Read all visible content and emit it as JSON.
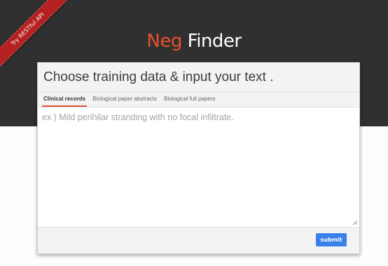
{
  "ribbon": {
    "label": "Try RESTful API"
  },
  "brand": {
    "accent": "Neg",
    "name": "Finder",
    "accent_color": "#e8522c"
  },
  "card": {
    "title": "Choose training data & input your text ."
  },
  "tabs": [
    {
      "label": "Clinical records",
      "active": true
    },
    {
      "label": "Biological paper abstracts",
      "active": false
    },
    {
      "label": "Biological full papers",
      "active": false
    }
  ],
  "input": {
    "value": "",
    "placeholder": "ex ) Mild perihilar stranding with no focal infiltrate."
  },
  "submit": {
    "label": "submit",
    "color": "#3a80ea"
  }
}
